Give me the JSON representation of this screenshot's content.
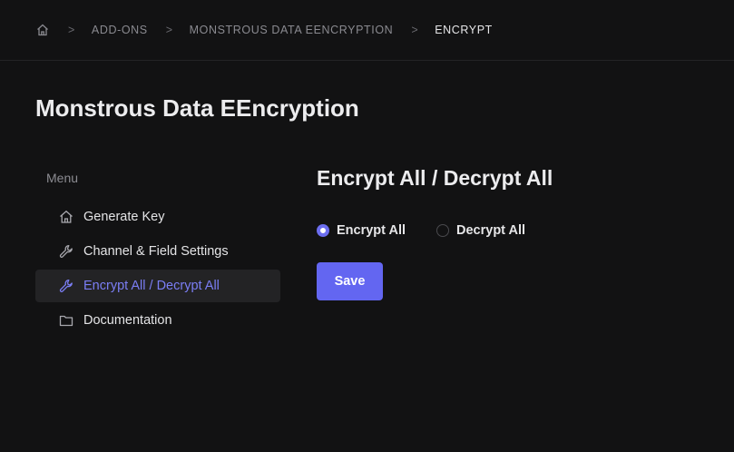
{
  "breadcrumb": {
    "home_icon": "home-icon",
    "items": [
      "ADD-ONS",
      "MONSTROUS DATA EENCRYPTION",
      "ENCRYPT"
    ],
    "separator": ">"
  },
  "page_title": "Monstrous Data EEncryption",
  "sidebar": {
    "menu_label": "Menu",
    "items": [
      {
        "label": "Generate Key",
        "icon": "home-icon",
        "active": false
      },
      {
        "label": "Channel & Field Settings",
        "icon": "wrench-icon",
        "active": false
      },
      {
        "label": "Encrypt All / Decrypt All",
        "icon": "wrench-icon",
        "active": true
      },
      {
        "label": "Documentation",
        "icon": "folder-icon",
        "active": false
      }
    ]
  },
  "main": {
    "heading": "Encrypt All / Decrypt All",
    "options": [
      {
        "label": "Encrypt All",
        "selected": true
      },
      {
        "label": "Decrypt All",
        "selected": false
      }
    ],
    "save_label": "Save"
  },
  "colors": {
    "accent": "#6366f1",
    "background": "#121213",
    "active_item_bg": "#232325"
  }
}
